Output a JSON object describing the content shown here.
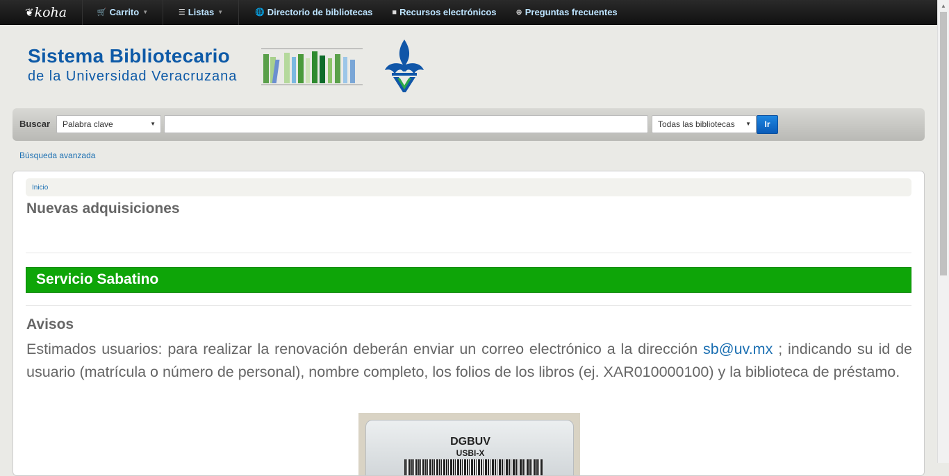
{
  "navbar": {
    "brand": "koha",
    "items": [
      {
        "label": "Carrito",
        "icon": "cart-icon",
        "glyph": "🛒"
      },
      {
        "label": "Listas",
        "icon": "list-icon",
        "glyph": "☰"
      },
      {
        "label": "Directorio de bibliotecas",
        "icon": "globe-icon",
        "glyph": "🌐"
      },
      {
        "label": "Recursos electrónicos",
        "icon": "book-icon",
        "glyph": "■"
      },
      {
        "label": "Preguntas frecuentes",
        "icon": "plus-circle-icon",
        "glyph": "⊕"
      }
    ]
  },
  "header": {
    "title": "Sistema Bibliotecario",
    "subtitle": "de la Universidad Veracruzana"
  },
  "search": {
    "label": "Buscar",
    "type_selected": "Palabra clave",
    "query_value": "",
    "library_selected": "Todas las bibliotecas",
    "go_label": "Ir",
    "advanced_link": "Búsqueda avanzada"
  },
  "main": {
    "breadcrumb": "Inicio",
    "page_title": "Nuevas adquisiciones",
    "banner": "Servicio Sabatino",
    "notices_title": "Avisos",
    "notice_text_before": "Estimados usuarios: para realizar la renovación deberán enviar un correo electrónico a la dirección",
    "notice_email": "sb@uv.mx",
    "notice_text_after": "; indicando su id de usuario (matrícula o número de personal), nombre completo, los folios de los libros (ej. XAR010000100) y la biblioteca de préstamo.",
    "card_line1": "DGBUV",
    "card_line2": "USBI-X"
  },
  "colors": {
    "navbar_link": "#bde4ff",
    "brand_blue": "#0e5aa7",
    "banner_green": "#0ea508",
    "link_blue": "#1b6fb2"
  }
}
